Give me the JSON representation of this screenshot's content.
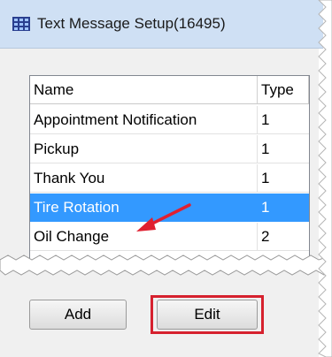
{
  "window": {
    "title": "Text Message Setup(16495)",
    "icon": "grid-app-icon"
  },
  "list": {
    "columns": [
      "Name",
      "Type"
    ],
    "rows": [
      {
        "name": "Appointment Notification",
        "type": "1"
      },
      {
        "name": "Pickup",
        "type": "1"
      },
      {
        "name": "Thank You",
        "type": "1"
      },
      {
        "name": "Tire Rotation",
        "type": "1",
        "selected": true
      },
      {
        "name": "Oil Change",
        "type": "2"
      }
    ]
  },
  "buttons": {
    "add": "Add",
    "edit": "Edit"
  },
  "colors": {
    "selection": "#3399ff",
    "highlight_frame": "#d6212e",
    "arrow": "#e02030"
  }
}
